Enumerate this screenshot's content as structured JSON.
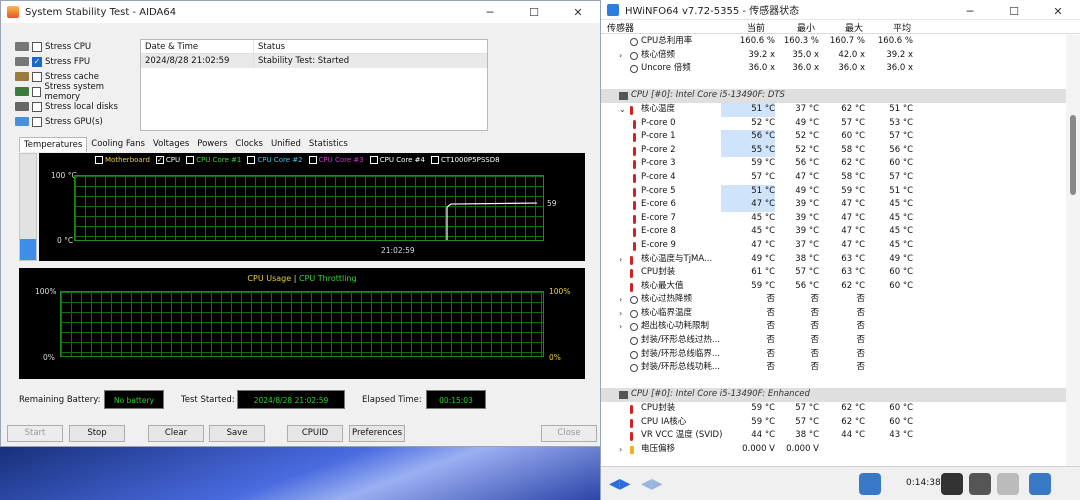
{
  "aida": {
    "title": "System Stability Test - AIDA64",
    "stress": [
      {
        "label": "Stress CPU",
        "checked": false
      },
      {
        "label": "Stress FPU",
        "checked": true
      },
      {
        "label": "Stress cache",
        "checked": false
      },
      {
        "label": "Stress system memory",
        "checked": false
      },
      {
        "label": "Stress local disks",
        "checked": false
      },
      {
        "label": "Stress GPU(s)",
        "checked": false
      }
    ],
    "log": {
      "col_date": "Date & Time",
      "col_status": "Status",
      "rows": [
        {
          "date": "2024/8/28 21:02:59",
          "status": "Stability Test: Started"
        }
      ]
    },
    "tabs": [
      "Temperatures",
      "Cooling Fans",
      "Voltages",
      "Powers",
      "Clocks",
      "Unified",
      "Statistics"
    ],
    "temp_chart": {
      "legend": [
        {
          "label": "Motherboard",
          "checked": false,
          "color": "#e6d23c"
        },
        {
          "label": "CPU",
          "checked": true,
          "color": "#ffffff"
        },
        {
          "label": "CPU Core #1",
          "checked": false,
          "color": "#35d635"
        },
        {
          "label": "CPU Core #2",
          "checked": false,
          "color": "#34c8e8"
        },
        {
          "label": "CPU Core #3",
          "checked": false,
          "color": "#d035d0"
        },
        {
          "label": "CPU Core #4",
          "checked": false,
          "color": "#ffffff"
        },
        {
          "label": "CT1000P5PSSD8",
          "checked": false,
          "color": "#ffffff"
        }
      ],
      "ymax": "100 °C",
      "ymin": "0 °C",
      "time": "21:02:59",
      "value": "59",
      "current": 59
    },
    "usage_chart": {
      "label_usage": "CPU Usage",
      "sep": "|",
      "label_throttle": "CPU Throttling",
      "top_left": "100%",
      "bottom_left": "0%",
      "top_right": "100%",
      "bottom_right": "0%"
    },
    "status": {
      "battery_label": "Remaining Battery:",
      "battery_value": "No battery",
      "started_label": "Test Started:",
      "started_value": "2024/8/28 21:02:59",
      "elapsed_label": "Elapsed Time:",
      "elapsed_value": "00:15:03"
    },
    "buttons": {
      "start": "Start",
      "stop": "Stop",
      "clear": "Clear",
      "save": "Save",
      "cpuid": "CPUID",
      "preferences": "Preferences",
      "close": "Close"
    },
    "battery_fill": 0.2
  },
  "hwinfo": {
    "title": "HWiNFO64 v7.72-5355 - 传感器状态",
    "headers": {
      "sensor": "传感器",
      "current": "当前",
      "min": "最小",
      "max": "最大",
      "avg": "平均"
    },
    "rows": [
      {
        "t": "item",
        "icon": "circle",
        "lvl": 0,
        "name": "CPU总利用率",
        "v": [
          "160.6 %",
          "160.3 %",
          "160.7 %",
          "160.6 %"
        ]
      },
      {
        "t": "item",
        "icon": "circle",
        "lvl": 0,
        "exp": ">",
        "name": "核心倍频",
        "v": [
          "39.2 x",
          "35.0 x",
          "42.0 x",
          "39.2 x"
        ]
      },
      {
        "t": "item",
        "icon": "circle",
        "lvl": 0,
        "name": "Uncore 倍频",
        "v": [
          "36.0 x",
          "36.0 x",
          "36.0 x",
          "36.0 x"
        ]
      },
      {
        "t": "blank"
      },
      {
        "t": "group",
        "name": "CPU [#0]: Intel Core i5-13490F: DTS"
      },
      {
        "t": "item",
        "icon": "therm",
        "lvl": 0,
        "exp": "v",
        "name": "核心温度",
        "v": [
          "51 °C",
          "37 °C",
          "62 °C",
          "51 °C"
        ],
        "hl": true
      },
      {
        "t": "item",
        "icon": "therm",
        "lvl": 2,
        "name": "P-core 0",
        "v": [
          "52 °C",
          "49 °C",
          "57 °C",
          "53 °C"
        ]
      },
      {
        "t": "item",
        "icon": "therm",
        "lvl": 2,
        "name": "P-core 1",
        "v": [
          "56 °C",
          "52 °C",
          "60 °C",
          "57 °C"
        ],
        "hl": true
      },
      {
        "t": "item",
        "icon": "therm",
        "lvl": 2,
        "name": "P-core 2",
        "v": [
          "55 °C",
          "52 °C",
          "58 °C",
          "56 °C"
        ],
        "hl": true
      },
      {
        "t": "item",
        "icon": "therm",
        "lvl": 2,
        "name": "P-core 3",
        "v": [
          "59 °C",
          "56 °C",
          "62 °C",
          "60 °C"
        ]
      },
      {
        "t": "item",
        "icon": "therm",
        "lvl": 2,
        "name": "P-core 4",
        "v": [
          "57 °C",
          "47 °C",
          "58 °C",
          "57 °C"
        ]
      },
      {
        "t": "item",
        "icon": "therm",
        "lvl": 2,
        "name": "P-core 5",
        "v": [
          "51 °C",
          "49 °C",
          "59 °C",
          "51 °C"
        ],
        "hl": true
      },
      {
        "t": "item",
        "icon": "therm",
        "lvl": 2,
        "name": "E-core 6",
        "v": [
          "47 °C",
          "39 °C",
          "47 °C",
          "45 °C"
        ],
        "hl": true
      },
      {
        "t": "item",
        "icon": "therm",
        "lvl": 2,
        "name": "E-core 7",
        "v": [
          "45 °C",
          "39 °C",
          "47 °C",
          "45 °C"
        ]
      },
      {
        "t": "item",
        "icon": "therm",
        "lvl": 2,
        "name": "E-core 8",
        "v": [
          "45 °C",
          "39 °C",
          "47 °C",
          "45 °C"
        ]
      },
      {
        "t": "item",
        "icon": "therm",
        "lvl": 2,
        "name": "E-core 9",
        "v": [
          "47 °C",
          "37 °C",
          "47 °C",
          "45 °C"
        ]
      },
      {
        "t": "item",
        "icon": "therm",
        "lvl": 0,
        "exp": ">",
        "name": "核心温度与TjMA...",
        "v": [
          "49 °C",
          "38 °C",
          "63 °C",
          "49 °C"
        ]
      },
      {
        "t": "item",
        "icon": "therm",
        "lvl": 0,
        "name": "CPU封装",
        "v": [
          "61 °C",
          "57 °C",
          "63 °C",
          "60 °C"
        ]
      },
      {
        "t": "item",
        "icon": "therm",
        "lvl": 0,
        "name": "核心最大值",
        "v": [
          "59 °C",
          "56 °C",
          "62 °C",
          "60 °C"
        ]
      },
      {
        "t": "item",
        "icon": "circle",
        "lvl": 0,
        "exp": ">",
        "name": "核心过热降频",
        "v": [
          "否",
          "否",
          "否",
          ""
        ]
      },
      {
        "t": "item",
        "icon": "circle",
        "lvl": 0,
        "exp": ">",
        "name": "核心临界温度",
        "v": [
          "否",
          "否",
          "否",
          ""
        ]
      },
      {
        "t": "item",
        "icon": "circle",
        "lvl": 0,
        "exp": ">",
        "name": "超出核心功耗限制",
        "v": [
          "否",
          "否",
          "否",
          ""
        ]
      },
      {
        "t": "item",
        "icon": "circle",
        "lvl": 0,
        "name": "封装/环形总线过热...",
        "v": [
          "否",
          "否",
          "否",
          ""
        ]
      },
      {
        "t": "item",
        "icon": "circle",
        "lvl": 0,
        "name": "封装/环形总线临界...",
        "v": [
          "否",
          "否",
          "否",
          ""
        ]
      },
      {
        "t": "item",
        "icon": "circle",
        "lvl": 0,
        "name": "封装/环形总线功耗...",
        "v": [
          "否",
          "否",
          "否",
          ""
        ]
      },
      {
        "t": "blank"
      },
      {
        "t": "group",
        "name": "CPU [#0]: Intel Core i5-13490F: Enhanced"
      },
      {
        "t": "item",
        "icon": "therm",
        "lvl": 0,
        "name": "CPU封装",
        "v": [
          "59 °C",
          "57 °C",
          "62 °C",
          "60 °C"
        ]
      },
      {
        "t": "item",
        "icon": "therm",
        "lvl": 0,
        "name": "CPU IA核心",
        "v": [
          "59 °C",
          "57 °C",
          "62 °C",
          "60 °C"
        ]
      },
      {
        "t": "item",
        "icon": "therm",
        "lvl": 0,
        "name": "VR VCC 温度 (SVID)",
        "v": [
          "44 °C",
          "38 °C",
          "44 °C",
          "43 °C"
        ]
      },
      {
        "t": "item",
        "icon": "bolt",
        "lvl": 0,
        "exp": ">",
        "name": "电压偏移",
        "v": [
          "0.000 V",
          "0.000 V",
          "",
          ""
        ]
      }
    ],
    "footer": {
      "prev": "◀▶",
      "next": "◀▶",
      "time": "0:14:38"
    }
  }
}
